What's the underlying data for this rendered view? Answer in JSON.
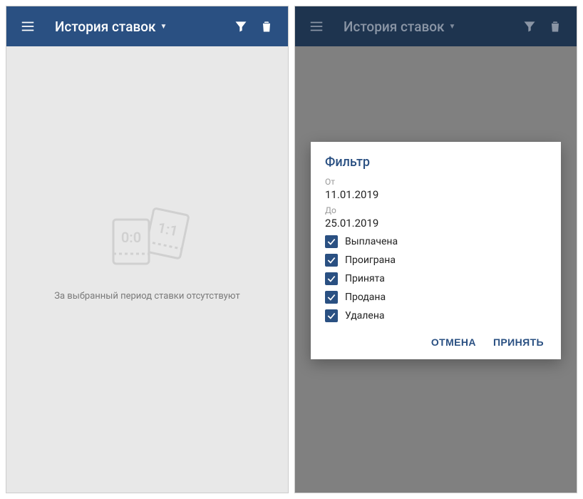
{
  "left": {
    "toolbar": {
      "title": "История ставок"
    },
    "empty_message": "За выбранный период ставки отсутствуют"
  },
  "right": {
    "toolbar": {
      "title": "История ставок"
    },
    "dialog": {
      "title": "Фильтр",
      "from_label": "От",
      "from_value": "11.01.2019",
      "to_label": "До",
      "to_value": "25.01.2019",
      "options": [
        {
          "label": "Выплачена",
          "checked": true
        },
        {
          "label": "Проиграна",
          "checked": true
        },
        {
          "label": "Принята",
          "checked": true
        },
        {
          "label": "Продана",
          "checked": true
        },
        {
          "label": "Удалена",
          "checked": true
        }
      ],
      "cancel": "ОТМЕНА",
      "accept": "ПРИНЯТЬ"
    }
  }
}
